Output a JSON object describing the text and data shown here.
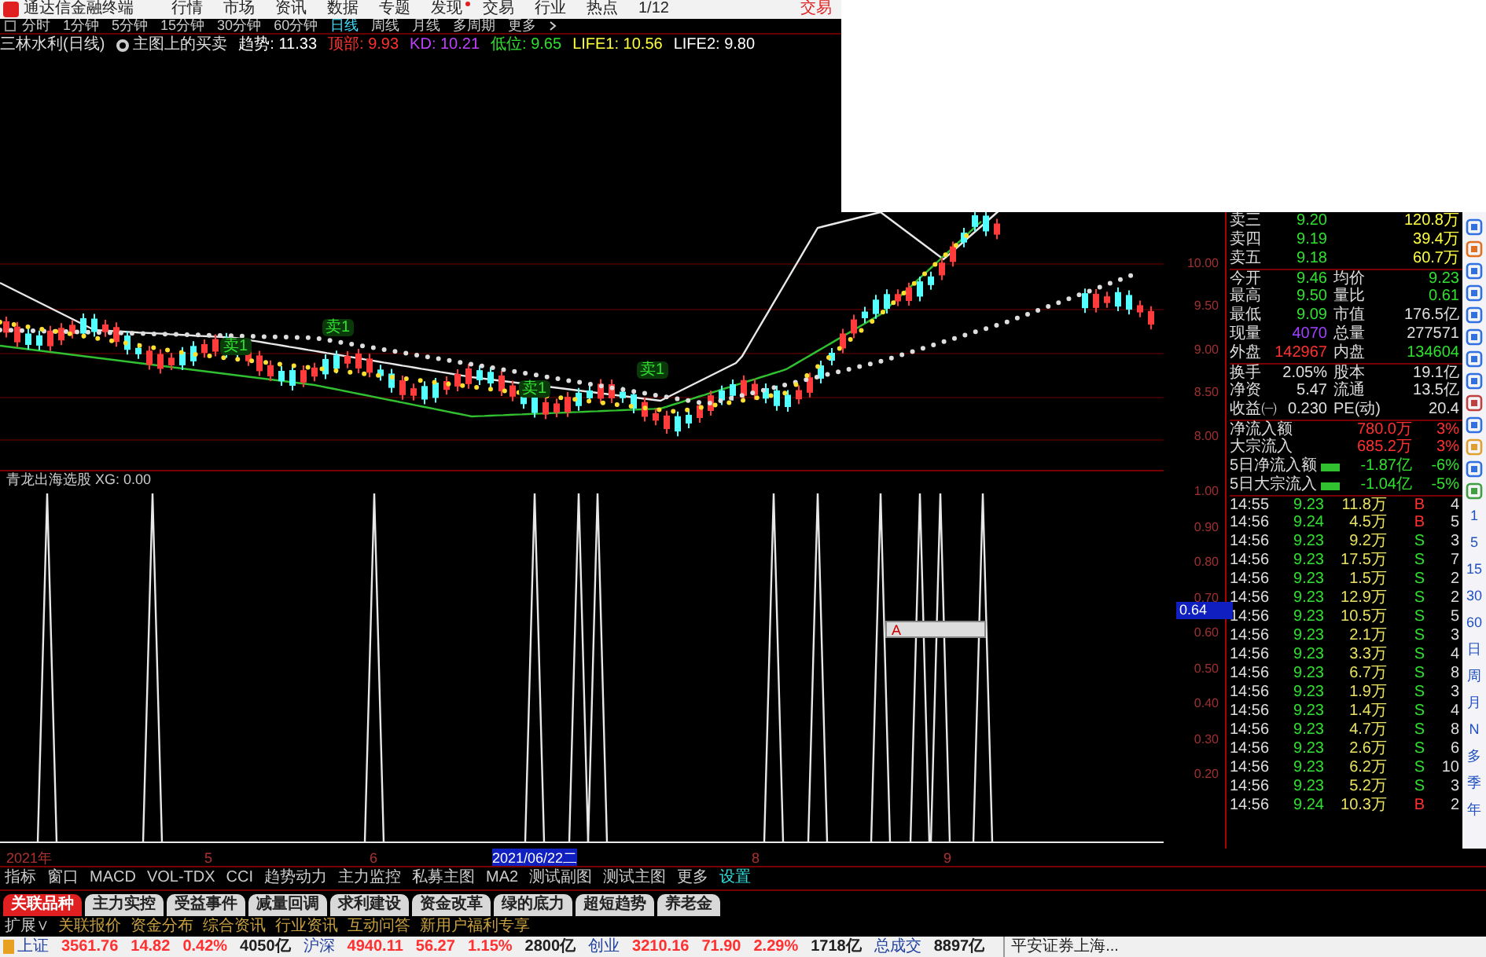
{
  "menu_bar": {
    "app_title": "通达信金融终端",
    "items": [
      {
        "label": "行情",
        "badge": false
      },
      {
        "label": "市场",
        "badge": false
      },
      {
        "label": "资讯",
        "badge": false
      },
      {
        "label": "数据",
        "badge": false
      },
      {
        "label": "专题",
        "badge": false
      },
      {
        "label": "发现",
        "badge": true
      },
      {
        "label": "交易",
        "badge": false
      },
      {
        "label": "行业",
        "badge": false
      },
      {
        "label": "热点",
        "badge": false
      },
      {
        "label": "1/12",
        "badge": false
      }
    ],
    "trade_button": "交易"
  },
  "period_tabs": [
    {
      "label": "分时",
      "selected": false
    },
    {
      "label": "1分钟",
      "selected": false
    },
    {
      "label": "5分钟",
      "selected": false
    },
    {
      "label": "15分钟",
      "selected": false
    },
    {
      "label": "30分钟",
      "selected": false
    },
    {
      "label": "60分钟",
      "selected": false
    },
    {
      "label": "日线",
      "selected": true
    },
    {
      "label": "周线",
      "selected": false
    },
    {
      "label": "月线",
      "selected": false
    },
    {
      "label": "多周期",
      "selected": false
    },
    {
      "label": "更多",
      "selected": false
    }
  ],
  "indicator_line": {
    "stock": "三林水利(日线)",
    "formula": "主图上的买卖",
    "values": [
      {
        "text": "趋势: 11.33",
        "color": "#ffffff"
      },
      {
        "text": "顶部: 9.93",
        "color": "#ff3030"
      },
      {
        "text": "KD: 10.21",
        "color": "#c040ff"
      },
      {
        "text": "低位: 9.65",
        "color": "#30e030"
      },
      {
        "text": "LIFE1: 10.56",
        "color": "#ffff40"
      },
      {
        "text": "LIFE2: 9.80",
        "color": "#ffffff"
      }
    ]
  },
  "main_chart": {
    "signal_labels": [
      "卖1",
      "卖1",
      "卖1",
      "卖1"
    ]
  },
  "price_axis": [
    "10.00",
    "9.50",
    "9.00",
    "8.50",
    "8.00"
  ],
  "quote": {
    "rows": [
      {
        "label": "卖三",
        "value": {
          "text": "9.20",
          "color": "#30e030"
        },
        "value2": {
          "text": "120.8万",
          "color": "#ffff40"
        }
      },
      {
        "label": "卖四",
        "value": {
          "text": "9.19",
          "color": "#30e030"
        },
        "value2": {
          "text": "39.4万",
          "color": "#ffff40"
        }
      },
      {
        "label": "卖五",
        "value": {
          "text": "9.18",
          "color": "#30e030"
        },
        "value2": {
          "text": "60.7万",
          "color": "#ffff40"
        }
      },
      {
        "label": "今开",
        "value": {
          "text": "9.46",
          "color": "#30e030"
        },
        "label2": "均价",
        "value2": {
          "text": "9.23",
          "color": "#30e030"
        }
      },
      {
        "label": "最高",
        "value": {
          "text": "9.50",
          "color": "#30e030"
        },
        "label2": "量比",
        "value2": {
          "text": "0.61",
          "color": "#30e030"
        }
      },
      {
        "label": "最低",
        "value": {
          "text": "9.09",
          "color": "#30e030"
        },
        "label2": "市值",
        "value2": {
          "text": "176.5亿",
          "color": "#e0e0e0"
        }
      },
      {
        "label": "现量",
        "value": {
          "text": "4070",
          "color": "#a040ff"
        },
        "label2": "总量",
        "value2": {
          "text": "277571",
          "color": "#e0e0e0"
        }
      },
      {
        "label": "外盘",
        "value": {
          "text": "142967",
          "color": "#ff3030"
        },
        "label2": "内盘",
        "value2": {
          "text": "134604",
          "color": "#30e030"
        }
      },
      {
        "label": "换手",
        "value": {
          "text": "2.05%",
          "color": "#e0e0e0"
        },
        "label2": "股本",
        "value2": {
          "text": "19.1亿",
          "color": "#e0e0e0"
        }
      },
      {
        "label": "净资",
        "value": {
          "text": "5.47",
          "color": "#e0e0e0"
        },
        "label2": "流通",
        "value2": {
          "text": "13.5亿",
          "color": "#e0e0e0"
        }
      },
      {
        "label": "收益㈠",
        "value": {
          "text": "0.230",
          "color": "#e0e0e0"
        },
        "label2": "PE(动)",
        "value2": {
          "text": "20.4",
          "color": "#e0e0e0"
        }
      }
    ],
    "flows": [
      {
        "label": "净流入额",
        "bar": false,
        "value": "780.0万",
        "percent": "3%",
        "color": "#ff3030"
      },
      {
        "label": "大宗流入",
        "bar": false,
        "value": "685.2万",
        "percent": "3%",
        "color": "#ff3030"
      },
      {
        "label": "5日净流入额",
        "bar": true,
        "value": "-1.87亿",
        "percent": "-6%",
        "color": "#30e030"
      },
      {
        "label": "5日大宗流入",
        "bar": true,
        "value": "-1.04亿",
        "percent": "-5%",
        "color": "#30e030"
      }
    ],
    "ticks": [
      {
        "time": "14:55",
        "price": "9.23",
        "volume": "11.8万",
        "side": "B",
        "count": "4"
      },
      {
        "time": "14:56",
        "price": "9.24",
        "volume": "4.5万",
        "side": "B",
        "count": "5"
      },
      {
        "time": "14:56",
        "price": "9.23",
        "volume": "9.2万",
        "side": "S",
        "count": "3"
      },
      {
        "time": "14:56",
        "price": "9.23",
        "volume": "17.5万",
        "side": "S",
        "count": "7"
      },
      {
        "time": "14:56",
        "price": "9.23",
        "volume": "1.5万",
        "side": "S",
        "count": "2"
      },
      {
        "time": "14:56",
        "price": "9.23",
        "volume": "12.9万",
        "side": "S",
        "count": "2"
      },
      {
        "time": "14:56",
        "price": "9.23",
        "volume": "10.5万",
        "side": "S",
        "count": "5"
      },
      {
        "time": "14:56",
        "price": "9.23",
        "volume": "2.1万",
        "side": "S",
        "count": "3"
      },
      {
        "time": "14:56",
        "price": "9.23",
        "volume": "3.3万",
        "side": "S",
        "count": "4"
      },
      {
        "time": "14:56",
        "price": "9.23",
        "volume": "6.7万",
        "side": "S",
        "count": "8"
      },
      {
        "time": "14:56",
        "price": "9.23",
        "volume": "1.9万",
        "side": "S",
        "count": "3"
      },
      {
        "time": "14:56",
        "price": "9.23",
        "volume": "1.4万",
        "side": "S",
        "count": "4"
      },
      {
        "time": "14:56",
        "price": "9.23",
        "volume": "4.7万",
        "side": "S",
        "count": "8"
      },
      {
        "time": "14:56",
        "price": "9.23",
        "volume": "2.6万",
        "side": "S",
        "count": "6"
      },
      {
        "time": "14:56",
        "price": "9.23",
        "volume": "6.2万",
        "side": "S",
        "count": "10"
      },
      {
        "time": "14:56",
        "price": "9.23",
        "volume": "5.2万",
        "side": "S",
        "count": "3"
      },
      {
        "time": "14:56",
        "price": "9.24",
        "volume": "10.3万",
        "side": "B",
        "count": "2"
      }
    ]
  },
  "side_bar": {
    "period_keys": [
      "1",
      "5",
      "15",
      "30",
      "60",
      "日",
      "周",
      "月",
      "N",
      "多",
      "季",
      "年"
    ]
  },
  "signal_panel": {
    "title": "青龙出海选股 XG: 0.00",
    "axis": [
      "1.00",
      "0.90",
      "0.80",
      "0.70",
      "0.60",
      "0.50",
      "0.40",
      "0.30",
      "0.20"
    ],
    "cursor_value": "0.64",
    "tooltip": "A"
  },
  "date_axis": [
    "2021年",
    "5",
    "6",
    "2021/06/22二",
    "8",
    "9"
  ],
  "indicator_tabs": [
    "指标",
    "窗口",
    "MACD",
    "VOL-TDX",
    "CCI",
    "趋势动力",
    "主力监控",
    "私募主图",
    "MA2",
    "测试副图",
    "测试主图",
    "更多",
    "设置"
  ],
  "feature_tabs": [
    {
      "label": "关联品种",
      "selected": true
    },
    {
      "label": "主力实控",
      "selected": false
    },
    {
      "label": "受益事件",
      "selected": false
    },
    {
      "label": "减量回调",
      "selected": false
    },
    {
      "label": "求利建设",
      "selected": false
    },
    {
      "label": "资金改革",
      "selected": false
    },
    {
      "label": "绿的底力",
      "selected": false
    },
    {
      "label": "超短趋势",
      "selected": false
    },
    {
      "label": "养老金",
      "selected": false
    }
  ],
  "extension_row": {
    "toggle": "扩展∨",
    "links": [
      "关联报价",
      "资金分布",
      "综合资讯",
      "行业资讯",
      "互动问答",
      "新用户福利专享"
    ]
  },
  "status_bar": {
    "indices": [
      {
        "name": "上证",
        "values": [
          {
            "text": "3561.76",
            "color": "#ff3030"
          },
          {
            "text": "14.82",
            "color": "#ff3030"
          },
          {
            "text": "0.42%",
            "color": "#ff3030"
          },
          {
            "text": "4050亿",
            "color": "#202020"
          }
        ]
      },
      {
        "name": "沪深",
        "values": [
          {
            "text": "4940.11",
            "color": "#ff3030"
          },
          {
            "text": "56.27",
            "color": "#ff3030"
          },
          {
            "text": "1.15%",
            "color": "#ff3030"
          },
          {
            "text": "2800亿",
            "color": "#202020"
          }
        ]
      },
      {
        "name": "创业",
        "values": [
          {
            "text": "3210.16",
            "color": "#ff3030"
          },
          {
            "text": "71.90",
            "color": "#ff3030"
          },
          {
            "text": "2.29%",
            "color": "#ff3030"
          },
          {
            "text": "1718亿",
            "color": "#202020"
          }
        ]
      },
      {
        "name": "总成交",
        "values": [
          {
            "text": "8897亿",
            "color": "#202020"
          }
        ]
      }
    ],
    "broker": "平安证券上海..."
  }
}
